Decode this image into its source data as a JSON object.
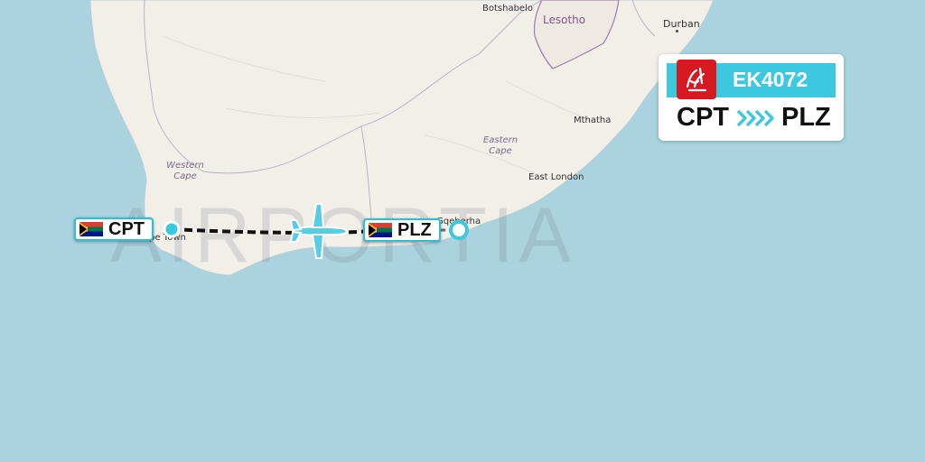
{
  "watermark": "AIRPORTIA",
  "map_labels": {
    "botshabelo": "Botshabelo",
    "lesotho": "Lesotho",
    "durban": "Durban",
    "mthatha": "Mthatha",
    "eastern_cape": "Eastern\nCape",
    "western_cape": "Western\nCape",
    "east_london": "East London",
    "cape_town": "Cape Town",
    "gqeberha": "Gqeberha"
  },
  "origin": {
    "code": "CPT",
    "flag": "South Africa"
  },
  "destination": {
    "code": "PLZ",
    "flag": "South Africa"
  },
  "flight_card": {
    "flight_number": "EK4072",
    "airline_logo": "emirates-logo",
    "from": "CPT",
    "to": "PLZ",
    "arrow_icon": "chevron-arrows-icon"
  },
  "colors": {
    "sea": "#aad3df",
    "land": "#f2efe9",
    "accent": "#3cc9df",
    "airline_red": "#d71a21",
    "route_line": "#111111"
  }
}
